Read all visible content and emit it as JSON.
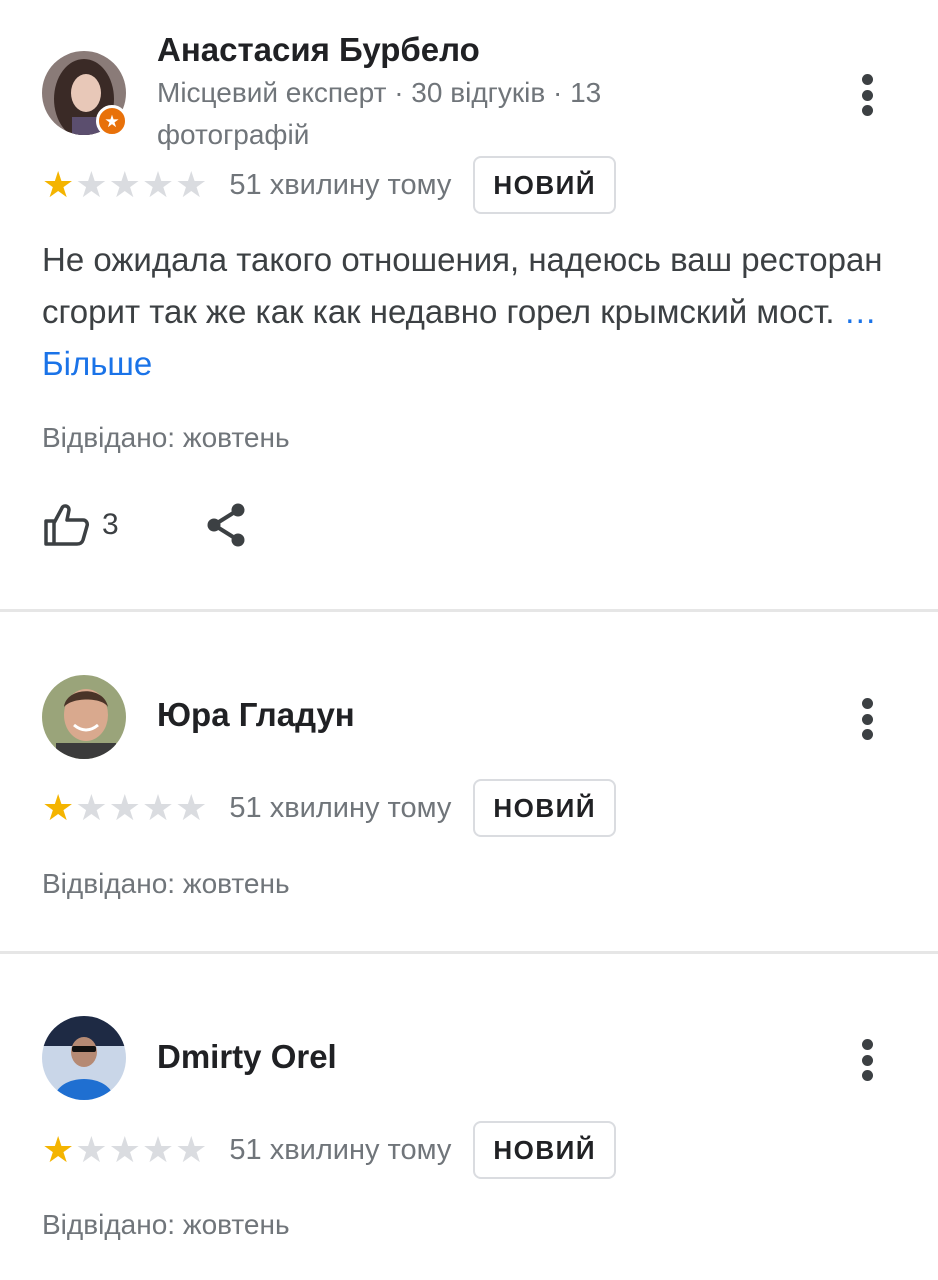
{
  "reviews": [
    {
      "author": "Анастасия Бурбело",
      "meta": "Місцевий експерт · 30 відгуків · 13 фотографій",
      "stars_filled": 1,
      "stars_total": 5,
      "time": "51 хвилину тому",
      "badge": "НОВИЙ",
      "text": "Не ожидала такого отношения, надеюсь ваш ресторан сгорит так же как как недавно горел крымский мост. ",
      "more_label": "…Більше",
      "visited": "Відвідано: жовтень",
      "likes": "3"
    },
    {
      "author": "Юра Гладун",
      "stars_filled": 1,
      "stars_total": 5,
      "time": "51 хвилину тому",
      "badge": "НОВИЙ",
      "visited": "Відвідано: жовтень"
    },
    {
      "author": "Dmirty Orel",
      "stars_filled": 1,
      "stars_total": 5,
      "time": "51 хвилину тому",
      "badge": "НОВИЙ",
      "visited": "Відвідано: жовтень"
    }
  ],
  "icons": {
    "more": "more-vert-icon",
    "like": "thumb-up-icon",
    "share": "share-icon",
    "guide": "local-guide-star-icon",
    "star": "star-icon"
  },
  "colors": {
    "star_filled": "#f4b400",
    "star_empty": "#dadce0",
    "link": "#1a73e8",
    "guide_badge": "#e8710a",
    "secondary_text": "#70757a"
  }
}
